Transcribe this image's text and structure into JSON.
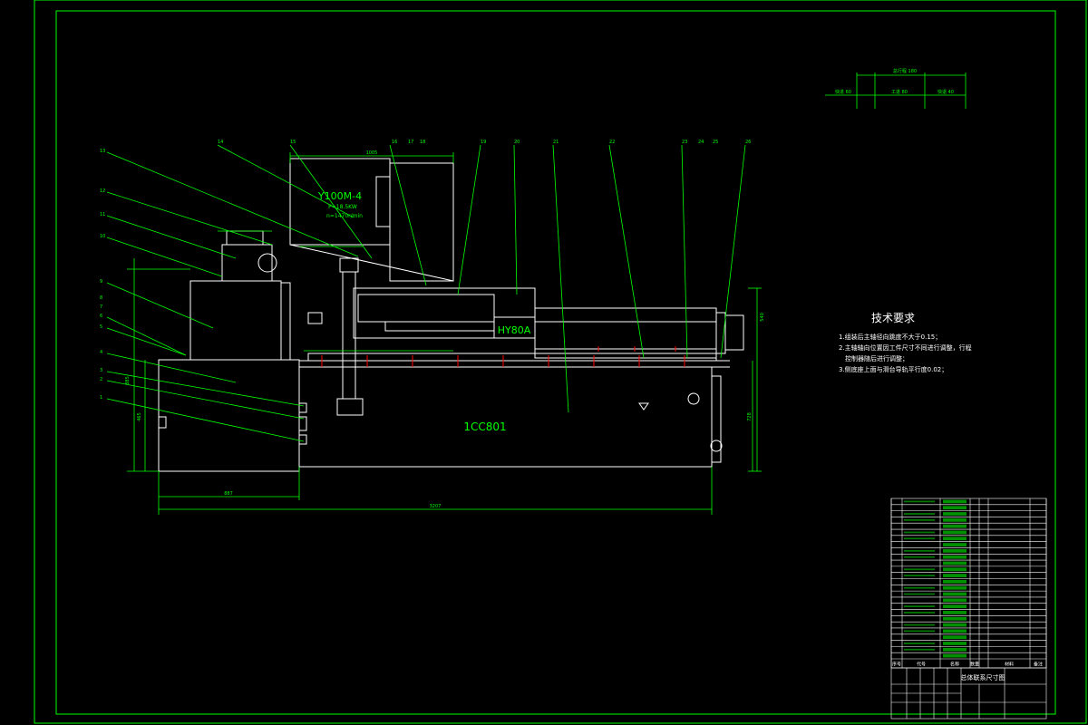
{
  "colors": {
    "background": "#000000",
    "border": "#00ff00",
    "outline": "#ffffff",
    "dimension": "#00ff00",
    "highlight": "#ff0000"
  },
  "motor": {
    "model": "Y100M-4",
    "power": "P=18.5KW",
    "speed": "n=1470r/min"
  },
  "slide_label": "HY80A",
  "base_label": "1CC801",
  "tech_title": "技术要求",
  "tech_requirements": [
    "1.组装后主轴径向跳度不大于0.15；",
    "2.主轴轴向位置因工件尺寸不同进行调整，行程",
    "控制器随后进行调整；",
    "3.侧底座上面与滑台导轨平行度0.02；"
  ],
  "dimensions": {
    "overall_length": "3207",
    "left_base_length": "887",
    "top_span": "1005",
    "base_height": "465",
    "height_right": "728",
    "height_left": "885",
    "right_height_short": "540"
  },
  "callouts": [
    "1",
    "2",
    "3",
    "4",
    "5",
    "6",
    "7",
    "8",
    "9",
    "10",
    "11",
    "12",
    "13",
    "14",
    "15",
    "16",
    "17",
    "18",
    "19",
    "20",
    "21",
    "22",
    "23",
    "24",
    "25",
    "26"
  ],
  "title_block": {
    "drawing_title": "总体联系尺寸图"
  },
  "bom_headers": [
    "序号",
    "代号",
    "名称",
    "数量",
    "材料",
    "备注"
  ],
  "top_right_dims": [
    "总行程 180",
    "快进 60",
    "工进 80",
    "快退 40"
  ]
}
